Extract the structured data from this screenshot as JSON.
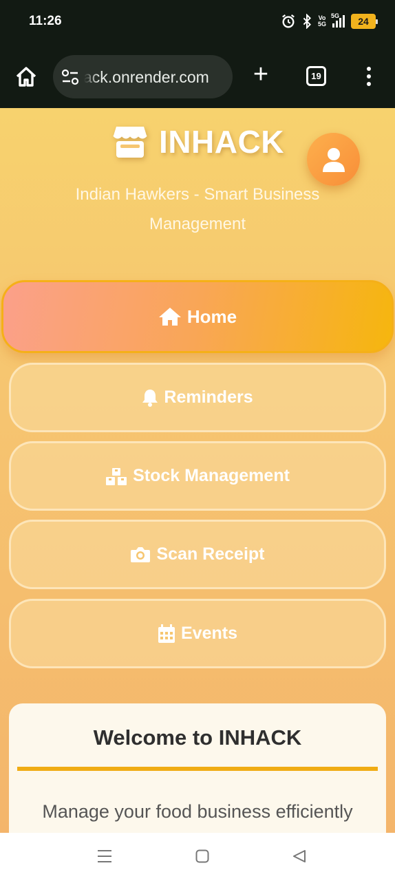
{
  "status_bar": {
    "time": "11:26",
    "network_type": "5G",
    "volte_label": [
      "Vo",
      "5G"
    ],
    "battery_level": "24",
    "icons": [
      "alarm-icon",
      "bluetooth-icon",
      "volte-icon",
      "signal-icon",
      "battery-icon"
    ]
  },
  "browser": {
    "url": "inhack.onrender.com",
    "url_visible": "ack.onrender.com",
    "tab_count": "19",
    "new_tab_label": "+"
  },
  "app": {
    "title": "INHACK",
    "subtitle": "Indian Hawkers - Smart Business Management",
    "nav": [
      {
        "label": "Home",
        "icon": "home-icon",
        "active": true
      },
      {
        "label": "Reminders",
        "icon": "bell-icon",
        "active": false
      },
      {
        "label": "Stock Management",
        "icon": "boxes-icon",
        "active": false
      },
      {
        "label": "Scan Receipt",
        "icon": "camera-icon",
        "active": false
      },
      {
        "label": "Events",
        "icon": "calendar-icon",
        "active": false
      }
    ],
    "welcome": {
      "title": "Welcome to INHACK",
      "text": "Manage your food business efficiently"
    }
  },
  "colors": {
    "accent": "#f0ac14",
    "avatar_gradient": [
      "#fdb04d",
      "#f88e38"
    ],
    "active_nav_gradient": [
      "#fba08a",
      "#f9a656",
      "#f6b60e"
    ],
    "browser_chrome": "#121a13"
  }
}
